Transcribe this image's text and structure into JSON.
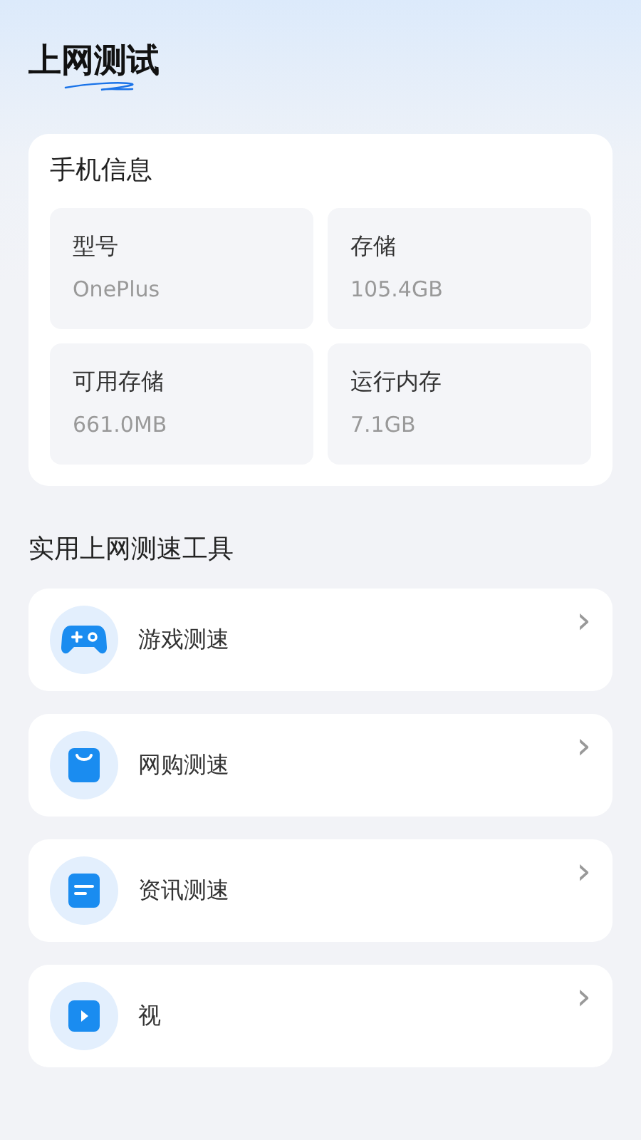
{
  "header": {
    "title": "上网测试"
  },
  "phone_info": {
    "title": "手机信息",
    "items": [
      {
        "label": "型号",
        "value": "OnePlus"
      },
      {
        "label": "存储",
        "value": "105.4GB"
      },
      {
        "label": "可用存储",
        "value": "661.0MB"
      },
      {
        "label": "运行内存",
        "value": "7.1GB"
      }
    ]
  },
  "tools": {
    "title": "实用上网测速工具",
    "items": [
      {
        "kind": "game",
        "label": "游戏测速",
        "chevron": "›"
      },
      {
        "kind": "shop",
        "label": "网购测速",
        "chevron": "›"
      },
      {
        "kind": "news",
        "label": "资讯测速",
        "chevron": "›"
      },
      {
        "kind": "video",
        "label": "视",
        "chevron": "›"
      }
    ]
  }
}
